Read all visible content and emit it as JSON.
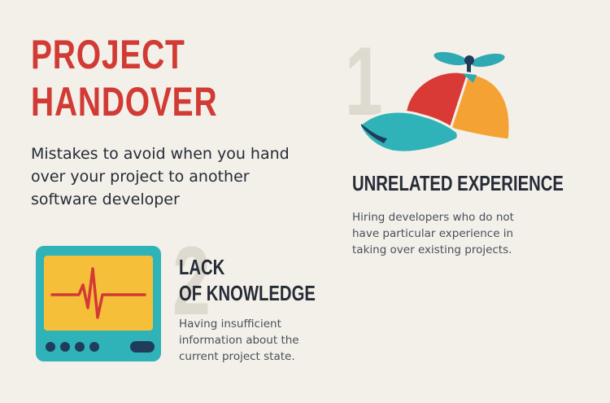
{
  "header": {
    "title_line1": "PROJECT",
    "title_line2": "HANDOVER",
    "subtitle": "Mistakes to avoid when you hand over your project to another software developer"
  },
  "items": [
    {
      "number": "1",
      "title": "UNRELATED EXPERIENCE",
      "description": "Hiring developers who do not have particular experience in taking over existing projects.",
      "icon": "propeller-cap-icon"
    },
    {
      "number": "2",
      "title_line1": "LACK",
      "title_line2": "OF KNOWLEDGE",
      "description": "Having insufficient information about the current project state.",
      "icon": "heart-monitor-icon"
    }
  ],
  "colors": {
    "background": "#f2f0e9",
    "title_red": "#d23a34",
    "dark_text": "#262b36",
    "number_ghost": "#dedacf",
    "teal": "#2fb3b8",
    "yellow": "#f6bf3a",
    "orange": "#f5a234",
    "navy": "#1f3d5a"
  }
}
